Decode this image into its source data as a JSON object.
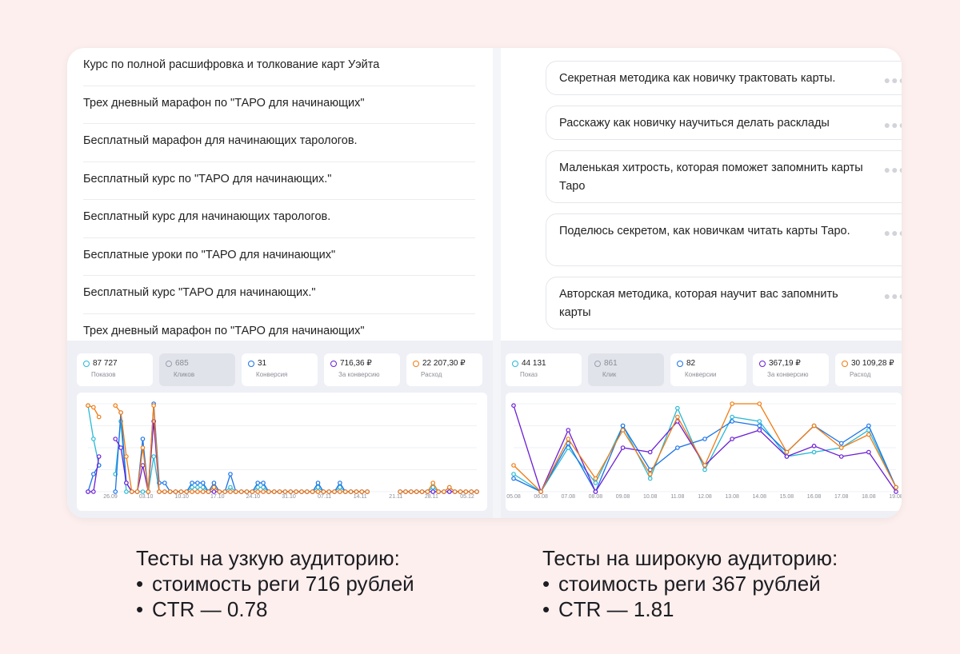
{
  "left": {
    "items": [
      "Курс по полной расшифровка и толкование карт Уэйта",
      "Трех дневный марафон по \"ТАРО для начинающих\"",
      "Бесплатный марафон для начинающих тарологов.",
      "Бесплатный курс по \"ТАРО для начинающих.\"",
      "Бесплатный курс для начинающих тарологов.",
      "Бесплатные уроки по \"ТАРО для начинающих\"",
      "Бесплатный курс \"ТАРО для начинающих.\"",
      "Трех дневный марафон по \"ТАРО для начинающих\""
    ],
    "stats": [
      {
        "value": "87 727",
        "label": "Показов",
        "color": "#29b9d6"
      },
      {
        "value": "685",
        "label": "Кликов",
        "color": "#9aa0ac"
      },
      {
        "value": "31",
        "label": "Конверсия",
        "color": "#1a73e8"
      },
      {
        "value": "716,36 ₽",
        "label": "За конверсию",
        "color": "#6b1fd6"
      },
      {
        "value": "22 207,30 ₽",
        "label": "Расход",
        "color": "#f07c12"
      }
    ]
  },
  "right": {
    "items": [
      "Секретная методика как новичку трактовать карты.",
      "Расскажу как новичку научиться делать расклады",
      "Маленькая хитрость, которая поможет запомнить карты Таро",
      "Поделюсь секретом, как новичкам читать карты Таро.",
      "Авторская методика, которая научит вас запомнить карты"
    ],
    "stats": [
      {
        "value": "44 131",
        "label": "Показ",
        "color": "#29b9d6"
      },
      {
        "value": "861",
        "label": "Клик",
        "color": "#9aa0ac"
      },
      {
        "value": "82",
        "label": "Конверсии",
        "color": "#1a73e8"
      },
      {
        "value": "367,19 ₽",
        "label": "За конверсию",
        "color": "#6b1fd6"
      },
      {
        "value": "30 109,28 ₽",
        "label": "Расход",
        "color": "#f07c12"
      }
    ]
  },
  "captions": {
    "left": {
      "title": "Тесты на узкую аудиторию:",
      "bullet1": "стоимость реги 716 рублей",
      "bullet2": "CTR — 0.78"
    },
    "right": {
      "title": "Тесты на широкую аудиторию:",
      "bullet1": "стоимость реги 367 рублей",
      "bullet2": "CTR — 1.81"
    }
  },
  "chart_data": [
    {
      "type": "line",
      "x_ticks": [
        "26.09",
        "03.10",
        "10.10",
        "17.10",
        "24.10",
        "31.10",
        "07.11",
        "14.11",
        "21.11",
        "28.11",
        "05.12"
      ],
      "x_count": 72,
      "ylim": [
        0,
        1
      ],
      "grid": true,
      "series": [
        {
          "color": "#29b9d6",
          "values": [
            0.98,
            0.6,
            0.3,
            null,
            null,
            0.2,
            0.8,
            0.0,
            0.0,
            0.0,
            0.0,
            0.0,
            0.4,
            0.0,
            0.0,
            0.0,
            0.0,
            0.0,
            0.0,
            0.05,
            0.05,
            0.05,
            0.0,
            0.05,
            0.0,
            0.0,
            0.05,
            0.0,
            0.0,
            0.0,
            0.0,
            0.05,
            0.05,
            0.0,
            0.0,
            0.0,
            0.0,
            0.0,
            0.0,
            0.0,
            0.0,
            0.0,
            0.05,
            0.0,
            0.0,
            0.0,
            0.05,
            0.0,
            0.0,
            0.0,
            0.0,
            0.0,
            null,
            null,
            null,
            null,
            null,
            0.0,
            0.0,
            0.0,
            0.0,
            0.0,
            0.0,
            0.05,
            0.0,
            0.0,
            0.05,
            0.0,
            0.0,
            0.0,
            0.0,
            0.0
          ]
        },
        {
          "color": "#1a73e8",
          "values": [
            0.0,
            0.2,
            0.3,
            null,
            null,
            0.0,
            0.9,
            0.1,
            0.0,
            0.0,
            0.6,
            0.0,
            1.0,
            0.1,
            0.1,
            0.0,
            0.0,
            0.0,
            0.0,
            0.1,
            0.1,
            0.1,
            0.0,
            0.1,
            0.0,
            0.0,
            0.2,
            0.0,
            0.0,
            0.0,
            0.0,
            0.1,
            0.1,
            0.0,
            0.0,
            0.0,
            0.0,
            0.0,
            0.0,
            0.0,
            0.0,
            0.0,
            0.1,
            0.0,
            0.0,
            0.0,
            0.1,
            0.0,
            0.0,
            0.0,
            0.0,
            0.0,
            null,
            null,
            null,
            null,
            null,
            0.0,
            0.0,
            0.0,
            0.0,
            0.0,
            0.0,
            0.0,
            0.0,
            0.0,
            0.0,
            0.0,
            0.0,
            0.0,
            0.0,
            0.0
          ]
        },
        {
          "color": "#6b1fd6",
          "values": [
            0.0,
            0.0,
            0.4,
            null,
            null,
            0.6,
            0.5,
            0.1,
            0.0,
            0.0,
            0.3,
            0.0,
            0.8,
            0.0,
            0.0,
            0.0,
            0.0,
            0.0,
            0.0,
            0.0,
            0.0,
            0.0,
            0.0,
            0.0,
            0.0,
            0.0,
            0.0,
            0.0,
            0.0,
            0.0,
            0.0,
            0.0,
            0.0,
            0.0,
            0.0,
            0.0,
            0.0,
            0.0,
            0.0,
            0.0,
            0.0,
            0.0,
            0.0,
            0.0,
            0.0,
            0.0,
            0.0,
            0.0,
            0.0,
            0.0,
            0.0,
            0.0,
            null,
            null,
            null,
            null,
            null,
            0.0,
            0.0,
            0.0,
            0.0,
            0.0,
            0.0,
            0.0,
            0.0,
            0.0,
            0.0,
            0.0,
            0.0,
            0.0,
            0.0,
            0.0
          ]
        },
        {
          "color": "#f07c12",
          "values": [
            0.98,
            0.96,
            0.85,
            null,
            null,
            0.98,
            0.9,
            0.4,
            0.0,
            0.0,
            0.5,
            0.0,
            0.98,
            0.0,
            0.0,
            0.0,
            0.0,
            0.0,
            0.0,
            0.0,
            0.0,
            0.0,
            0.0,
            0.05,
            0.0,
            0.0,
            0.0,
            0.0,
            0.0,
            0.0,
            0.0,
            0.0,
            0.0,
            0.0,
            0.0,
            0.0,
            0.0,
            0.0,
            0.0,
            0.0,
            0.0,
            0.0,
            0.0,
            0.0,
            0.0,
            0.0,
            0.0,
            0.0,
            0.0,
            0.0,
            0.0,
            0.0,
            null,
            null,
            null,
            null,
            null,
            0.0,
            0.0,
            0.0,
            0.0,
            0.0,
            0.0,
            0.1,
            0.0,
            0.0,
            0.05,
            0.0,
            0.0,
            0.0,
            0.0,
            0.0
          ]
        }
      ]
    },
    {
      "type": "line",
      "x_ticks": [
        "05.08",
        "06.08",
        "07.08",
        "08.08",
        "09.08",
        "10.08",
        "11.08",
        "12.08",
        "13.08",
        "14.08",
        "15.08",
        "16.08",
        "17.08",
        "18.08",
        "19.08"
      ],
      "x_count": 15,
      "ylim": [
        0,
        1
      ],
      "grid": true,
      "series": [
        {
          "color": "#29b9d6",
          "values": [
            0.2,
            0.0,
            0.5,
            0.1,
            0.75,
            0.15,
            0.95,
            0.25,
            0.85,
            0.8,
            0.4,
            0.45,
            0.5,
            0.7,
            0.05
          ]
        },
        {
          "color": "#1a73e8",
          "values": [
            0.15,
            0.0,
            0.55,
            0.0,
            0.75,
            0.25,
            0.5,
            0.6,
            0.8,
            0.75,
            0.45,
            0.75,
            0.55,
            0.75,
            0.05
          ]
        },
        {
          "color": "#6b1fd6",
          "values": [
            0.98,
            0.0,
            0.7,
            0.0,
            0.5,
            0.45,
            0.8,
            0.3,
            0.6,
            0.7,
            0.4,
            0.52,
            0.4,
            0.45,
            0.0
          ]
        },
        {
          "color": "#f07c12",
          "values": [
            0.3,
            0.0,
            0.6,
            0.15,
            0.7,
            0.2,
            0.85,
            0.3,
            1.0,
            1.0,
            0.45,
            0.75,
            0.5,
            0.65,
            0.05
          ]
        }
      ]
    }
  ]
}
